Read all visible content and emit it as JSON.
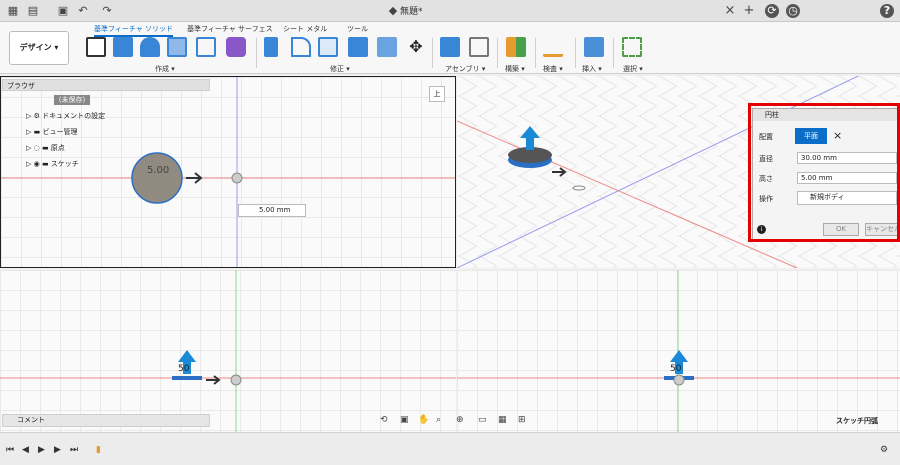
{
  "titlebar": {
    "document_title": "無題*",
    "close_glyph": "×",
    "add_glyph": "+",
    "help_glyph": "?"
  },
  "ribbon": {
    "workspace_button": "デザイン ▾",
    "tabs": [
      "基準フィーチャ ソリッド",
      "基準フィーチャ サーフェス",
      "シート メタル",
      "ツール"
    ],
    "groups": [
      "作成 ▾",
      "修正 ▾",
      "アセンブリ ▾",
      "構築 ▾",
      "検査 ▾",
      "挿入 ▾",
      "選択 ▾"
    ]
  },
  "browser": {
    "title": "ブラウザ",
    "items": [
      {
        "label": "(未保存)"
      },
      {
        "label": "ドキュメントの設定"
      },
      {
        "label": "ビュー管理"
      },
      {
        "label": "原点"
      },
      {
        "label": "スケッチ"
      }
    ]
  },
  "viewport_top_left": {
    "circle_label": "5.00",
    "dimension_input_value": "5.00 mm",
    "viewcube_label": "上"
  },
  "dialog": {
    "title": "円柱",
    "placement_label": "配置",
    "placement_value": "平面",
    "diameter_label": "直径",
    "diameter_value": "30.00 mm",
    "height_label": "高さ",
    "height_value": "5.00 mm",
    "operation_label": "操作",
    "operation_value": "新規ボディ",
    "ok_label": "OK",
    "cancel_label": "キャンセル"
  },
  "viewport_bottom_left": {
    "label": "50"
  },
  "viewport_bottom_right": {
    "label": "50",
    "status_text": "スケッチ円弧"
  },
  "comment": {
    "label": "コメント"
  },
  "colors": {
    "accent": "#0a6ec9",
    "highlight_frame": "#e40000",
    "cylinder_blue": "#2b6fc4"
  }
}
